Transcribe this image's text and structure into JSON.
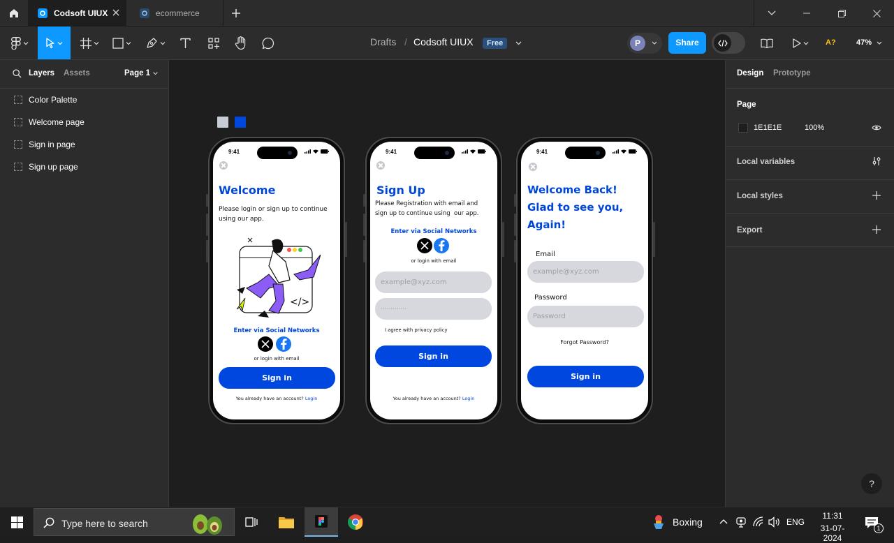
{
  "tabs": [
    {
      "label": "Codsoft UIUX",
      "active": true
    },
    {
      "label": "ecommerce",
      "active": false
    }
  ],
  "toolbar": {
    "breadcrumb_root": "Drafts",
    "file_name": "Codsoft UIUX",
    "plan_badge": "Free",
    "avatar_initial": "P",
    "share_label": "Share",
    "access_label": "A?",
    "zoom": "47%"
  },
  "left_panel": {
    "tab_layers": "Layers",
    "tab_assets": "Assets",
    "page_selector": "Page 1",
    "layers": [
      {
        "label": "Color Palette"
      },
      {
        "label": "Welcome page"
      },
      {
        "label": "Sign in page"
      },
      {
        "label": "Sign up page"
      }
    ]
  },
  "right_panel": {
    "tab_design": "Design",
    "tab_prototype": "Prototype",
    "page_heading": "Page",
    "page_color": "1E1E1E",
    "page_opacity": "100%",
    "local_variables": "Local variables",
    "local_styles": "Local styles",
    "export": "Export",
    "help": "?"
  },
  "canvas": {
    "palette_colors": [
      "#c7ccd6",
      "#0047e0"
    ],
    "welcome_screen": {
      "time": "9:41",
      "title": "Welcome",
      "description_line1": "Please login or sign up to continue",
      "description_line2": "using our app.",
      "social_heading": "Enter via Social Networks",
      "or_email": "or login with email",
      "button": "Sign in",
      "footer_text": "You already have an account?",
      "footer_link": "Login"
    },
    "signup_screen": {
      "time": "9:41",
      "title": "Sign Up",
      "description_line1": "Please Registration with email and",
      "description_line2": "sign up to continue using  our app.",
      "social_heading": "Enter via Social Networks",
      "or_email": "or login with email",
      "email_placeholder": "example@xyz.com",
      "password_mask": "·············",
      "agree_text": "I agree with privacy policy",
      "button": "Sign in",
      "footer_text": "You already have an account?",
      "footer_link": "Login"
    },
    "signin_screen": {
      "time": "9:41",
      "title_line1": "Welcome Back!",
      "title_line2": "Glad to see you,",
      "title_line3": "Again!",
      "email_label": "Email",
      "email_placeholder": "example@xyz.com",
      "password_label": "Password",
      "password_placeholder": "Password",
      "forgot": "Forgot Password?",
      "button": "Sign in"
    }
  },
  "taskbar": {
    "search_placeholder": "Type here to search",
    "weather_label": "Boxing",
    "language": "ENG",
    "time": "11:31",
    "date": "31-07-2024",
    "notification_count": "1"
  },
  "colors": {
    "accent_blue": "#0d99ff",
    "brand_blue": "#0047e0",
    "panel_bg": "#2c2c2c",
    "canvas_bg": "#1e1e1e"
  }
}
